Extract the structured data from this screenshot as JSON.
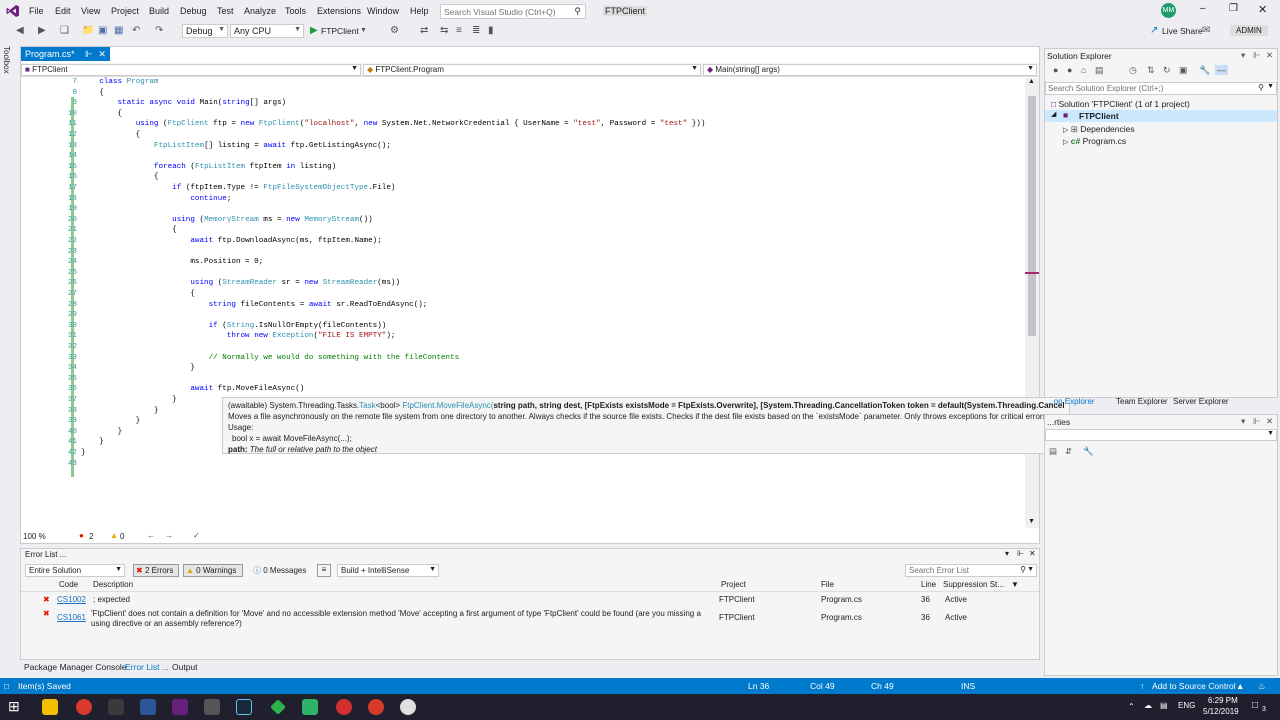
{
  "menubar": {
    "items": [
      "File",
      "Edit",
      "View",
      "Project",
      "Build",
      "Debug",
      "Test",
      "Analyze",
      "Tools",
      "Extensions",
      "Window",
      "Help"
    ],
    "search_placeholder": "Search Visual Studio (Ctrl+Q)",
    "solution_name": "FTPClient",
    "user_initials": "MM",
    "live_share": "Live Share",
    "admin": "ADMIN"
  },
  "toolbar": {
    "config": "Debug",
    "platform": "Any CPU",
    "run_target": "FTPClient"
  },
  "toolbox_label": "Toolbox",
  "editor": {
    "tab_label": "Program.cs*",
    "nav_project": "FTPClient",
    "nav_class": "FTPClient.Program",
    "nav_member": "Main(string[] args)",
    "zoom": "100 %",
    "error_count": "2",
    "warning_count": "0",
    "lines": [
      {
        "n": "7",
        "t": "    class Program"
      },
      {
        "n": "8",
        "t": "    {"
      },
      {
        "n": "9",
        "t": "        static async void Main(string[] args)"
      },
      {
        "n": "10",
        "t": "        {"
      },
      {
        "n": "11",
        "t": "            using (FtpClient ftp = new FtpClient(\"localhost\", new System.Net.NetworkCredential { UserName = \"test\", Password = \"test\" }))"
      },
      {
        "n": "12",
        "t": "            {"
      },
      {
        "n": "13",
        "t": "                FtpListItem[] listing = await ftp.GetListingAsync();"
      },
      {
        "n": "14",
        "t": ""
      },
      {
        "n": "15",
        "t": "                foreach (FtpListItem ftpItem in listing)"
      },
      {
        "n": "16",
        "t": "                {"
      },
      {
        "n": "17",
        "t": "                    if (ftpItem.Type != FtpFileSystemObjectType.File)"
      },
      {
        "n": "18",
        "t": "                        continue;"
      },
      {
        "n": "19",
        "t": ""
      },
      {
        "n": "20",
        "t": "                    using (MemoryStream ms = new MemoryStream())"
      },
      {
        "n": "21",
        "t": "                    {"
      },
      {
        "n": "22",
        "t": "                        await ftp.DownloadAsync(ms, ftpItem.Name);"
      },
      {
        "n": "23",
        "t": ""
      },
      {
        "n": "24",
        "t": "                        ms.Position = 0;"
      },
      {
        "n": "25",
        "t": ""
      },
      {
        "n": "26",
        "t": "                        using (StreamReader sr = new StreamReader(ms))"
      },
      {
        "n": "27",
        "t": "                        {"
      },
      {
        "n": "28",
        "t": "                            string fileContents = await sr.ReadToEndAsync();"
      },
      {
        "n": "29",
        "t": ""
      },
      {
        "n": "30",
        "t": "                            if (String.IsNullOrEmpty(fileContents))"
      },
      {
        "n": "31",
        "t": "                                throw new Exception(\"FILE IS EMPTY\");"
      },
      {
        "n": "32",
        "t": ""
      },
      {
        "n": "33",
        "t": "                            // Normally we would do something with the fileContents"
      },
      {
        "n": "34",
        "t": "                        }"
      },
      {
        "n": "35",
        "t": ""
      },
      {
        "n": "36",
        "t": "                        await ftp.MoveFileAsync()"
      },
      {
        "n": "37",
        "t": "                    }"
      },
      {
        "n": "38",
        "t": "                }"
      },
      {
        "n": "39",
        "t": "            }"
      },
      {
        "n": "40",
        "t": "        }"
      },
      {
        "n": "41",
        "t": "    }"
      },
      {
        "n": "42",
        "t": "}"
      },
      {
        "n": "43",
        "t": ""
      }
    ]
  },
  "tooltip": {
    "line1_prefix": "(awaitable) System.Threading.Tasks.",
    "line1_task": "Task",
    "line1_mid": "<bool> ",
    "line1_method": "FtpClient.MoveFileAsync(",
    "line1_params": "string path, string dest, [FtpExists existsMode = FtpExists.Overwrite], [System.Threading.CancellationToken token = default(System.Threading.CancellationToken)])",
    "line2": "Moves a file asynchronously on the remote file system from one directory to another. Always checks if the source file exists. Checks if the dest file exists based on the `existsMode` parameter. Only throws exceptions for critical errors.",
    "usage_label": "Usage:",
    "usage_code": "bool x = await MoveFileAsync(...);",
    "param_name": "path:",
    "param_desc": "The full or relative path to the object"
  },
  "error_list": {
    "title": "Error List ...",
    "scope": "Entire Solution",
    "errors_btn": "2 Errors",
    "warnings_btn": "0 Warnings",
    "messages_btn": "0 Messages",
    "build_filter": "Build + IntelliSense",
    "search_placeholder": "Search Error List",
    "headers": {
      "code": "Code",
      "description": "Description",
      "project": "Project",
      "file": "File",
      "line": "Line",
      "suppression": "Suppression St..."
    },
    "rows": [
      {
        "code": "CS1002",
        "description": "; expected",
        "project": "FTPClient",
        "file": "Program.cs",
        "line": "36",
        "state": "Active"
      },
      {
        "code": "CS1061",
        "description": "'FtpClient' does not contain a definition for 'Move' and no accessible extension method 'Move' accepting a first argument of type 'FtpClient' could be found (are you missing a using directive or an assembly reference?)",
        "project": "FTPClient",
        "file": "Program.cs",
        "line": "36",
        "state": "Active"
      }
    ]
  },
  "bottom_tabs": [
    "Package Manager Console",
    "Error List ...",
    "Output"
  ],
  "solution_explorer": {
    "title": "Solution Explorer",
    "search_placeholder": "Search Solution Explorer (Ctrl+;)",
    "solution_label": "Solution 'FTPClient' (1 of 1 project)",
    "project": "FTPClient",
    "dependencies": "Dependencies",
    "file": "Program.cs",
    "tabs": [
      "...on Explorer",
      "Team Explorer",
      "Server Explorer"
    ]
  },
  "properties_title": "...rties",
  "statusbar": {
    "left": "Item(s) Saved",
    "ln": "Ln 36",
    "col": "Col 49",
    "ch": "Ch 49",
    "ins": "INS",
    "source_control": "Add to Source Control"
  },
  "taskbar": {
    "lang": "ENG",
    "time": "6:29 PM",
    "date": "5/12/2019",
    "notif_count": "3"
  },
  "colors": {
    "accent": "#007acc",
    "error": "#e51400",
    "vs_purple": "#68217a"
  }
}
